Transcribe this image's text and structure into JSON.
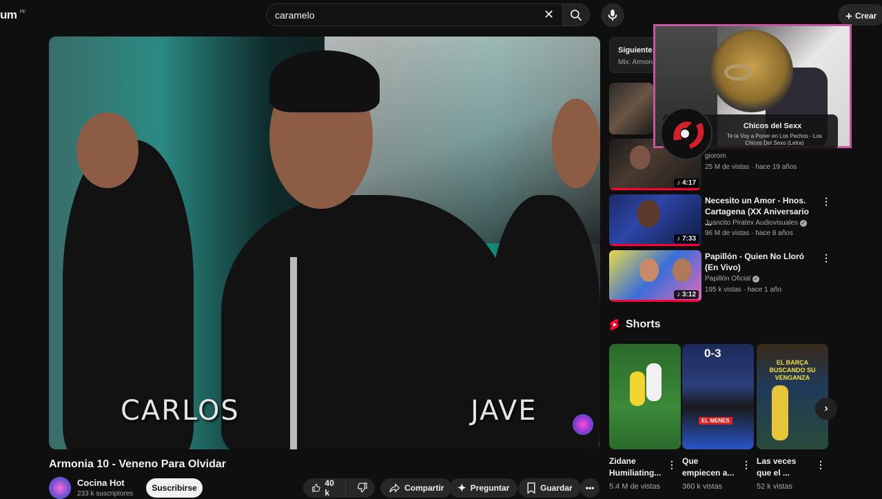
{
  "header": {
    "logo_text": "um",
    "country_code": "PE",
    "search_value": "caramelo",
    "create_label": "Crear"
  },
  "video": {
    "overlay_left": "CARLOS",
    "overlay_right": "JAVE",
    "title": "Armonia 10 - Veneno Para Olvidar",
    "channel": "Cocina Hot",
    "subscribers": "233 k suscriptores",
    "subscribe_label": "Suscribirse",
    "likes": "40 k",
    "share_label": "Compartir",
    "ask_label": "Preguntar",
    "save_label": "Guardar"
  },
  "up_next": {
    "label": "Siguiente:",
    "sub": "Mix: Armon"
  },
  "overlay": {
    "title": "Chicos del Sexx",
    "subtitle": "Te la Voy a Poner en Los Pechos - Los Chicos Del Sexo (Letra)"
  },
  "sidebar": {
    "items": [
      {
        "channel": "giorom",
        "meta": "25 M de vistas · hace 19 años",
        "duration": "4:17"
      },
      {
        "title": "Necesito un Amor - Hnos. Cartagena (XX Aniversario ...",
        "channel": "Juancito Piratex Audiovisuales",
        "meta": "96 M de vistas · hace 8 años",
        "duration": "7:33"
      },
      {
        "title": "Papillón  - Quien No Lloró (En Vivo)",
        "channel": "Papillón Oficial",
        "meta": "195 k vistas · hace 1 año",
        "duration": "3:12"
      }
    ]
  },
  "shorts": {
    "heading": "Shorts",
    "items": [
      {
        "title": "Zidane Humiliating...",
        "views": "5.4 M de vistas"
      },
      {
        "title": "Que empiecen a...",
        "views": "360 k vistas",
        "score": "0-3",
        "caption": "EL MENES"
      },
      {
        "title": "Las veces que el ...",
        "views": "52 k vistas",
        "caption": "EL BARÇA BUSCANDO SU VENGANZA"
      }
    ]
  },
  "colors": {
    "accent": "#ff0033",
    "bg": "#0f0f0f",
    "overlay_border": "#c7559f"
  }
}
